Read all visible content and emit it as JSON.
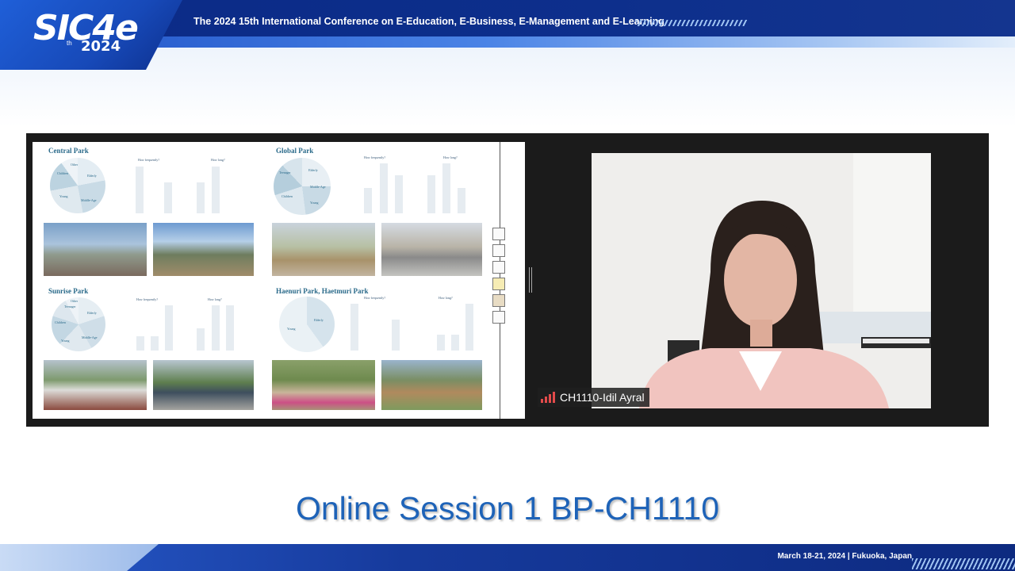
{
  "header": {
    "logo_main": "SIC4e",
    "logo_sup": "th",
    "logo_year": "2024",
    "conference_title": "The 2024 15th International Conference on E-Education, E-Business, E-Management and E-Learning"
  },
  "slide": {
    "parks": [
      {
        "title": "Central Park",
        "pie_labels": [
          "Other",
          "Children",
          "Young",
          "Elderly",
          "Middle-Age"
        ],
        "freq_title": "How frequently?",
        "long_title": "How long?",
        "photo_colors": [
          "#6d8aa8",
          "#7d9470"
        ]
      },
      {
        "title": "Global Park",
        "pie_labels": [
          "Teenager",
          "Elderly",
          "Middle-Age",
          "Children",
          "Young"
        ],
        "freq_title": "How frequently?",
        "long_title": "How long?",
        "photo_colors": [
          "#8f8a6a",
          "#9a9aa0"
        ]
      },
      {
        "title": "Sunrise Park",
        "pie_labels": [
          "Other",
          "Teenager",
          "Children",
          "Elderly",
          "Young",
          "Middle-Age"
        ],
        "freq_title": "How frequently?",
        "long_title": "How long?",
        "photo_colors": [
          "#6f8a62",
          "#5f7d5a"
        ]
      },
      {
        "title": "Haenuri Park, Haetmuri Park",
        "pie_labels": [
          "Elderly",
          "Young"
        ],
        "freq_title": "How frequently?",
        "long_title": "How long?",
        "photo_colors": [
          "#6f8f52",
          "#7a8a6a"
        ]
      }
    ]
  },
  "video": {
    "participant_name": "CH1110-Idil Ayral"
  },
  "session": {
    "title": "Online Session 1 BP-CH1110"
  },
  "footer": {
    "event_info": "March 18-21, 2024  |  Fukuoka, Japan"
  }
}
